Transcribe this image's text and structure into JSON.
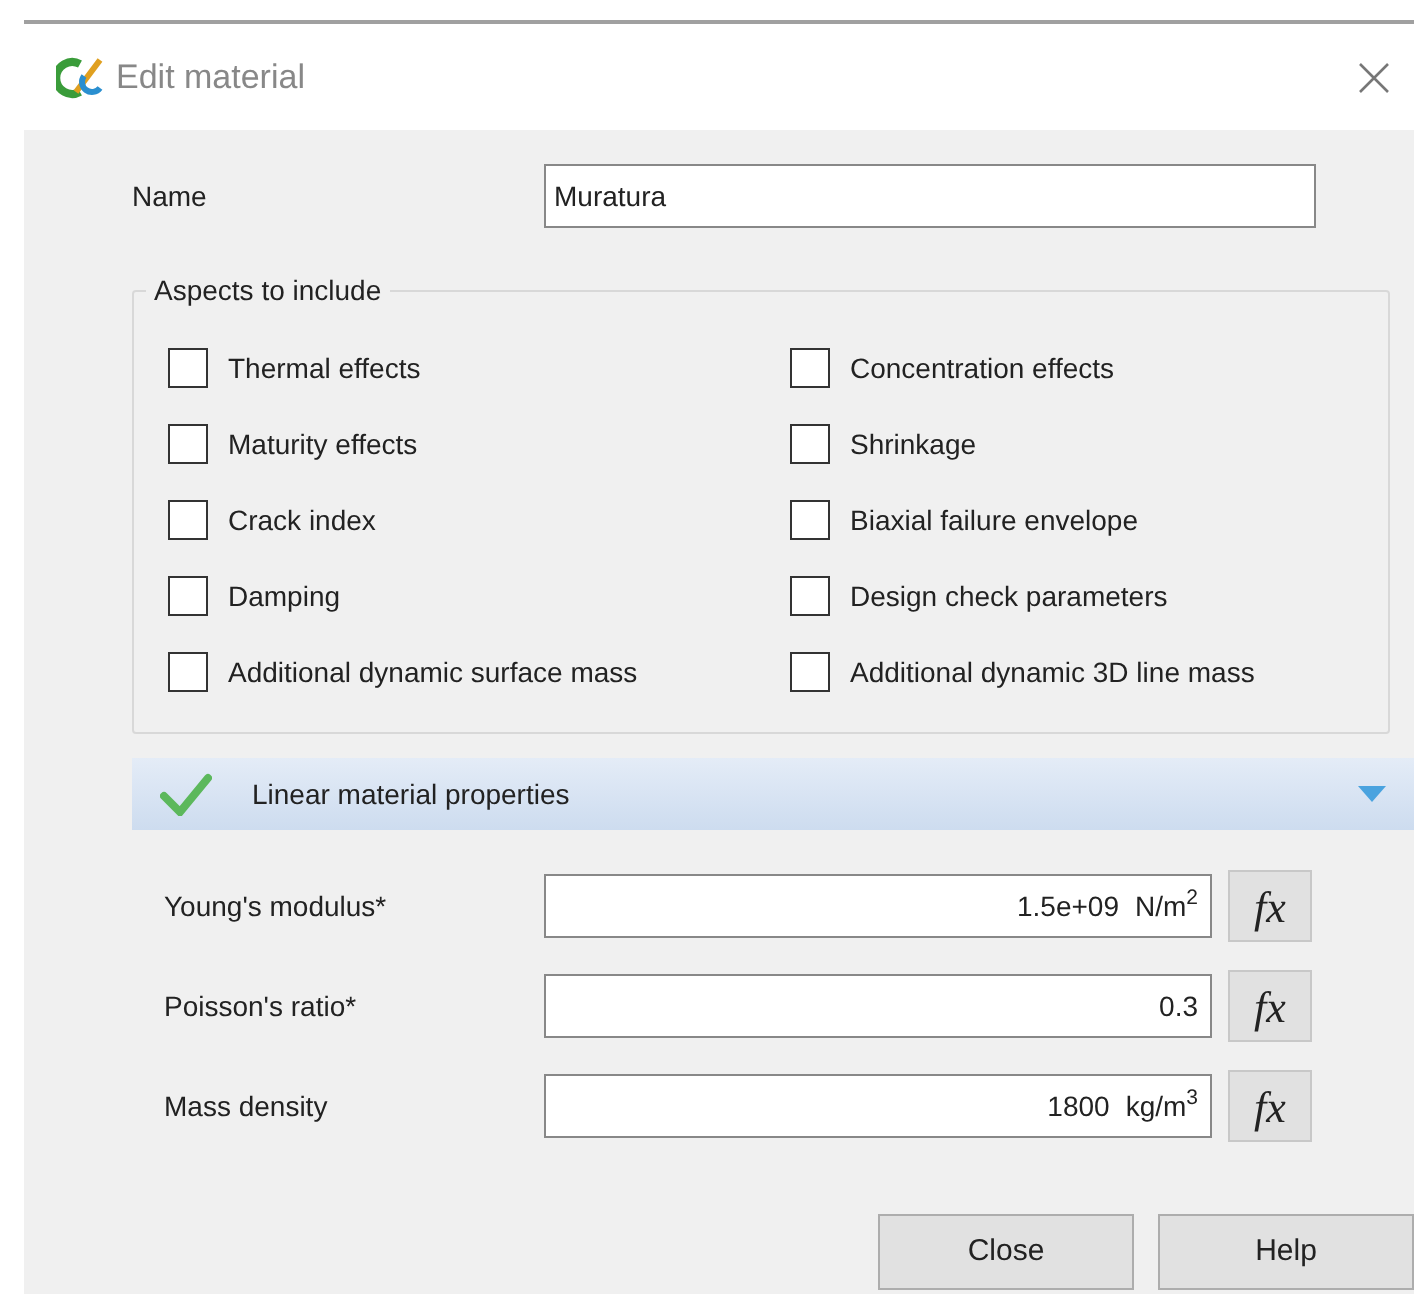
{
  "window": {
    "title": "Edit material"
  },
  "name_field": {
    "label": "Name",
    "value": "Muratura"
  },
  "aspects": {
    "title": "Aspects to include",
    "items": [
      {
        "label": "Thermal effects",
        "checked": false
      },
      {
        "label": "Concentration effects",
        "checked": false
      },
      {
        "label": "Maturity effects",
        "checked": false
      },
      {
        "label": "Shrinkage",
        "checked": false
      },
      {
        "label": "Crack index",
        "checked": false
      },
      {
        "label": "Biaxial failure envelope",
        "checked": false
      },
      {
        "label": "Damping",
        "checked": false
      },
      {
        "label": "Design check parameters",
        "checked": false
      },
      {
        "label": "Additional dynamic surface mass",
        "checked": false
      },
      {
        "label": "Additional dynamic 3D line mass",
        "checked": false
      }
    ]
  },
  "section": {
    "title": "Linear material properties",
    "complete": true,
    "expanded": true
  },
  "properties": [
    {
      "label": "Young's modulus*",
      "value": "1.5e+09",
      "unit": "N/m$^{2}$",
      "button": "fx"
    },
    {
      "label": "Poisson's ratio*",
      "value": "0.3",
      "button": "fx"
    },
    {
      "label": "Mass density",
      "value": "1800",
      "unit": "kg/m$^{3}$",
      "button": "fx"
    }
  ],
  "buttons": [
    "Close",
    "Help"
  ]
}
